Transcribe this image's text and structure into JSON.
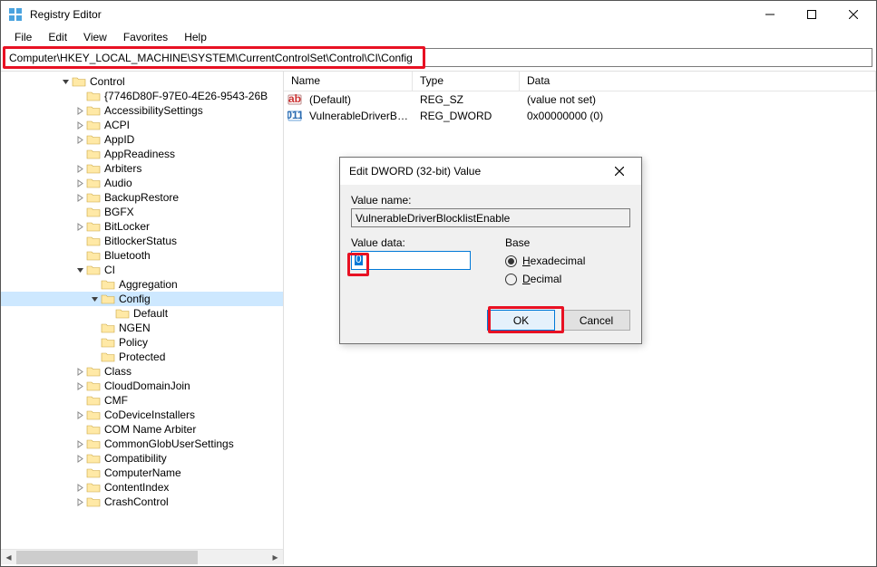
{
  "window": {
    "title": "Registry Editor"
  },
  "menu": {
    "file": "File",
    "edit": "Edit",
    "view": "View",
    "favorites": "Favorites",
    "help": "Help"
  },
  "address": {
    "value": "Computer\\HKEY_LOCAL_MACHINE\\SYSTEM\\CurrentControlSet\\Control\\CI\\Config"
  },
  "tree": [
    {
      "indent": 4,
      "expander": "open",
      "label": "Control"
    },
    {
      "indent": 5,
      "expander": "none",
      "label": "{7746D80F-97E0-4E26-9543-26B"
    },
    {
      "indent": 5,
      "expander": "closed",
      "label": "AccessibilitySettings"
    },
    {
      "indent": 5,
      "expander": "closed",
      "label": "ACPI"
    },
    {
      "indent": 5,
      "expander": "closed",
      "label": "AppID"
    },
    {
      "indent": 5,
      "expander": "none",
      "label": "AppReadiness"
    },
    {
      "indent": 5,
      "expander": "closed",
      "label": "Arbiters"
    },
    {
      "indent": 5,
      "expander": "closed",
      "label": "Audio"
    },
    {
      "indent": 5,
      "expander": "closed",
      "label": "BackupRestore"
    },
    {
      "indent": 5,
      "expander": "none",
      "label": "BGFX"
    },
    {
      "indent": 5,
      "expander": "closed",
      "label": "BitLocker"
    },
    {
      "indent": 5,
      "expander": "none",
      "label": "BitlockerStatus"
    },
    {
      "indent": 5,
      "expander": "none",
      "label": "Bluetooth"
    },
    {
      "indent": 5,
      "expander": "open",
      "label": "CI"
    },
    {
      "indent": 6,
      "expander": "none",
      "label": "Aggregation"
    },
    {
      "indent": 6,
      "expander": "open",
      "label": "Config",
      "selected": true
    },
    {
      "indent": 7,
      "expander": "none",
      "label": "Default"
    },
    {
      "indent": 6,
      "expander": "none",
      "label": "NGEN"
    },
    {
      "indent": 6,
      "expander": "none",
      "label": "Policy"
    },
    {
      "indent": 6,
      "expander": "none",
      "label": "Protected"
    },
    {
      "indent": 5,
      "expander": "closed",
      "label": "Class"
    },
    {
      "indent": 5,
      "expander": "closed",
      "label": "CloudDomainJoin"
    },
    {
      "indent": 5,
      "expander": "none",
      "label": "CMF"
    },
    {
      "indent": 5,
      "expander": "closed",
      "label": "CoDeviceInstallers"
    },
    {
      "indent": 5,
      "expander": "none",
      "label": "COM Name Arbiter"
    },
    {
      "indent": 5,
      "expander": "closed",
      "label": "CommonGlobUserSettings"
    },
    {
      "indent": 5,
      "expander": "closed",
      "label": "Compatibility"
    },
    {
      "indent": 5,
      "expander": "none",
      "label": "ComputerName"
    },
    {
      "indent": 5,
      "expander": "closed",
      "label": "ContentIndex"
    },
    {
      "indent": 5,
      "expander": "closed",
      "label": "CrashControl"
    }
  ],
  "list": {
    "columns": {
      "name": "Name",
      "type": "Type",
      "data": "Data"
    },
    "rows": [
      {
        "icon": "string",
        "name": "(Default)",
        "type": "REG_SZ",
        "data": "(value not set)"
      },
      {
        "icon": "binary",
        "name": "VulnerableDriverBloc...",
        "type": "REG_DWORD",
        "data": "0x00000000 (0)"
      }
    ]
  },
  "dialog": {
    "title": "Edit DWORD (32-bit) Value",
    "value_name_label": "Value name:",
    "value_name": "VulnerableDriverBlocklistEnable",
    "value_data_label": "Value data:",
    "value_data": "0",
    "base_label": "Base",
    "hex_label": "Hexadecimal",
    "dec_label": "Decimal",
    "ok": "OK",
    "cancel": "Cancel"
  }
}
